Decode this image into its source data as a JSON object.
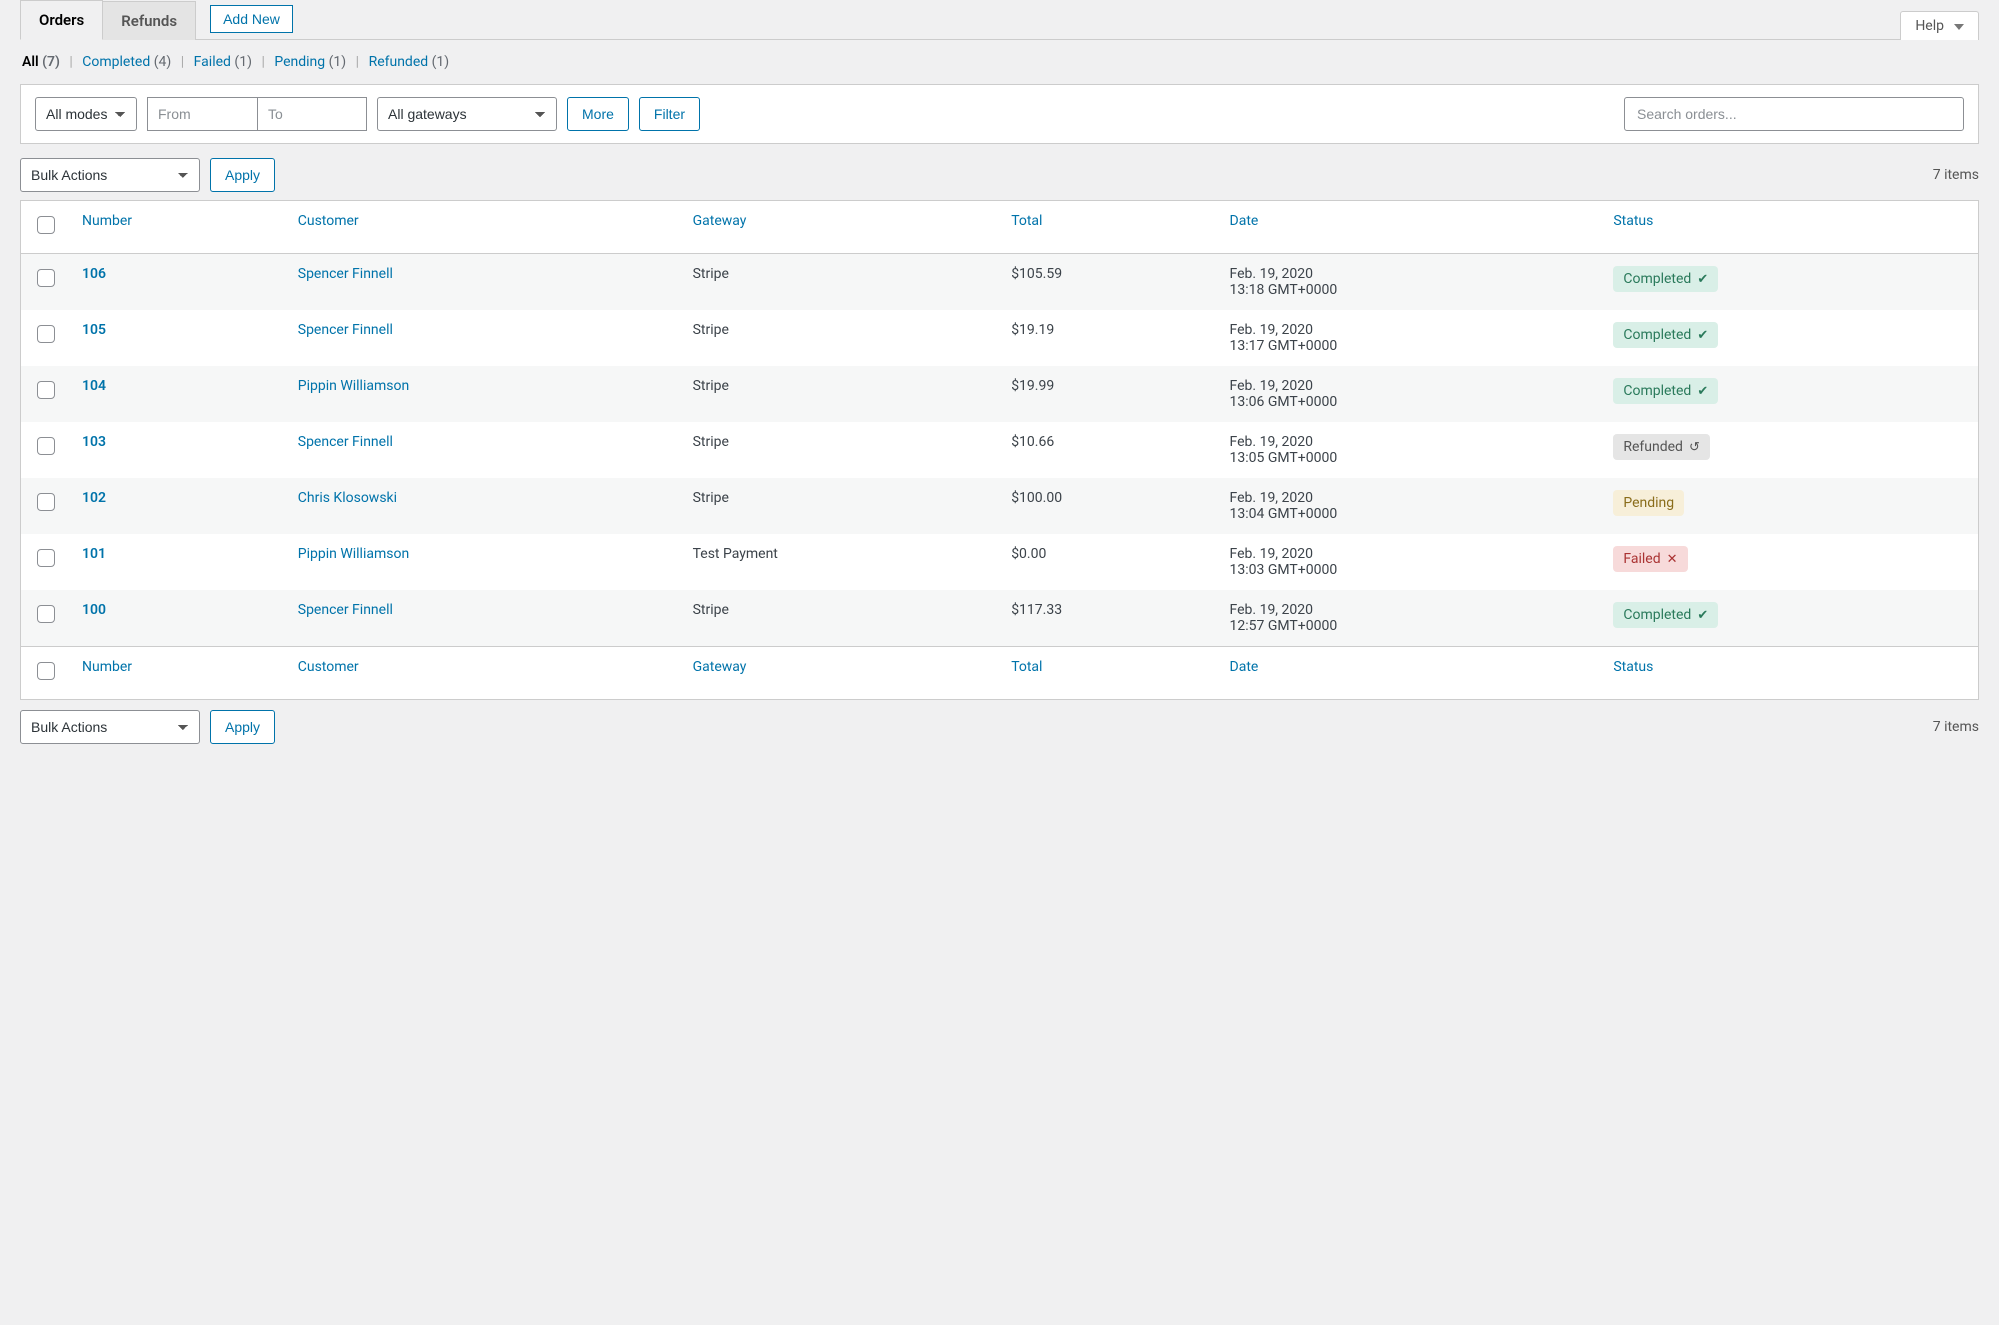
{
  "help_label": "Help",
  "tabs": {
    "orders": "Orders",
    "refunds": "Refunds"
  },
  "add_new": "Add New",
  "filters_sub": {
    "all_label": "All",
    "all_count": "(7)",
    "completed_label": "Completed",
    "completed_count": "(4)",
    "failed_label": "Failed",
    "failed_count": "(1)",
    "pending_label": "Pending",
    "pending_count": "(1)",
    "refunded_label": "Refunded",
    "refunded_count": "(1)"
  },
  "filter_bar": {
    "modes": "All modes",
    "from_placeholder": "From",
    "to_placeholder": "To",
    "gateways": "All gateways",
    "more": "More",
    "filter": "Filter",
    "search_placeholder": "Search orders..."
  },
  "bulk": {
    "label": "Bulk Actions",
    "apply": "Apply"
  },
  "items_count": "7 items",
  "columns": {
    "number": "Number",
    "customer": "Customer",
    "gateway": "Gateway",
    "total": "Total",
    "date": "Date",
    "status": "Status"
  },
  "status_labels": {
    "completed": "Completed",
    "refunded": "Refunded",
    "pending": "Pending",
    "failed": "Failed"
  },
  "rows": [
    {
      "number": "106",
      "customer": "Spencer Finnell",
      "gateway": "Stripe",
      "total": "$105.59",
      "date": "Feb. 19, 2020",
      "time": "13:18 GMT+0000",
      "status": "completed"
    },
    {
      "number": "105",
      "customer": "Spencer Finnell",
      "gateway": "Stripe",
      "total": "$19.19",
      "date": "Feb. 19, 2020",
      "time": "13:17 GMT+0000",
      "status": "completed"
    },
    {
      "number": "104",
      "customer": "Pippin Williamson",
      "gateway": "Stripe",
      "total": "$19.99",
      "date": "Feb. 19, 2020",
      "time": "13:06 GMT+0000",
      "status": "completed"
    },
    {
      "number": "103",
      "customer": "Spencer Finnell",
      "gateway": "Stripe",
      "total": "$10.66",
      "date": "Feb. 19, 2020",
      "time": "13:05 GMT+0000",
      "status": "refunded"
    },
    {
      "number": "102",
      "customer": "Chris Klosowski",
      "gateway": "Stripe",
      "total": "$100.00",
      "date": "Feb. 19, 2020",
      "time": "13:04 GMT+0000",
      "status": "pending"
    },
    {
      "number": "101",
      "customer": "Pippin Williamson",
      "gateway": "Test Payment",
      "total": "$0.00",
      "date": "Feb. 19, 2020",
      "time": "13:03 GMT+0000",
      "status": "failed"
    },
    {
      "number": "100",
      "customer": "Spencer Finnell",
      "gateway": "Stripe",
      "total": "$117.33",
      "date": "Feb. 19, 2020",
      "time": "12:57 GMT+0000",
      "status": "completed"
    }
  ]
}
